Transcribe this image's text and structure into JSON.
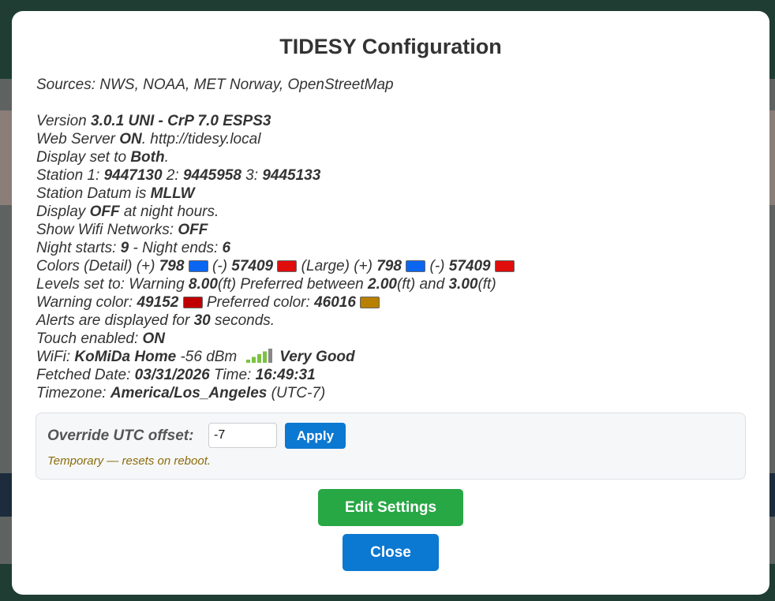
{
  "modal": {
    "title": "TIDESY Configuration",
    "sources": "Sources: NWS, NOAA, MET Norway, OpenStreetMap"
  },
  "info": {
    "version_label": "Version ",
    "version": "3.0.1 UNI - CrP 7.0 ESPS3",
    "webserver_label": "Web Server ",
    "webserver_state": "ON",
    "webserver_url": ". http://tidesy.local",
    "display_label": "Display set to ",
    "display_value": "Both",
    "display_end": ".",
    "station1_label": "Station 1: ",
    "station1": "9447130",
    "station2_label": " 2: ",
    "station2": "9445958",
    "station3_label": " 3: ",
    "station3": "9445133",
    "datum_label": "Station Datum is ",
    "datum": "MLLW",
    "night_display_label": "Display ",
    "night_display_state": "OFF",
    "night_display_end": " at night hours.",
    "wifi_networks_label": "Show Wifi Networks: ",
    "wifi_networks_state": "OFF",
    "night_starts_label": "Night starts: ",
    "night_starts": "9",
    "night_ends_label": " - Night ends: ",
    "night_ends": "6",
    "colors_detail_label": "Colors (Detail) (+) ",
    "colors_detail_plus": "798",
    "colors_minus_label": " (-) ",
    "colors_detail_minus": "57409",
    "colors_large_label": " (Large) (+) ",
    "colors_large_plus": "798",
    "colors_large_minus": "57409",
    "levels_label": "Levels set to: Warning ",
    "levels_warning": "8.00",
    "levels_pref_label": "(ft) Preferred between ",
    "levels_pref_low": "2.00",
    "levels_and": "(ft) and ",
    "levels_pref_high": "3.00",
    "levels_unit": "(ft)",
    "warning_color_label": "Warning color: ",
    "warning_color": "49152",
    "preferred_color_label": " Preferred color: ",
    "preferred_color": "46016",
    "alerts_label": "Alerts are displayed for ",
    "alerts_seconds": "30",
    "alerts_end": " seconds.",
    "touch_label": "Touch enabled: ",
    "touch_state": "ON",
    "wifi_label": "WiFi: ",
    "wifi_ssid": "KoMiDa Home",
    "wifi_dbm": " -56 dBm",
    "wifi_quality": "Very Good",
    "wifi_bars": 4,
    "fetched_label": "Fetched Date: ",
    "fetched_date": "03/31/2026",
    "time_label": " Time: ",
    "fetched_time": "16:49:31",
    "timezone_label": "Timezone: ",
    "timezone": "America/Los_Angeles",
    "timezone_offset": " (UTC-7)"
  },
  "colors": {
    "blue_swatch": "#0a66f0",
    "red_swatch": "#e00d0d",
    "warning_swatch": "#c00000",
    "preferred_swatch": "#b88000",
    "signal_on": "#7cc242",
    "signal_off": "#888888"
  },
  "override": {
    "label": "Override UTC offset:",
    "value": "-7",
    "apply_label": "Apply",
    "note": "Temporary — resets on reboot."
  },
  "buttons": {
    "edit_label": "Edit Settings",
    "close_label": "Close"
  }
}
